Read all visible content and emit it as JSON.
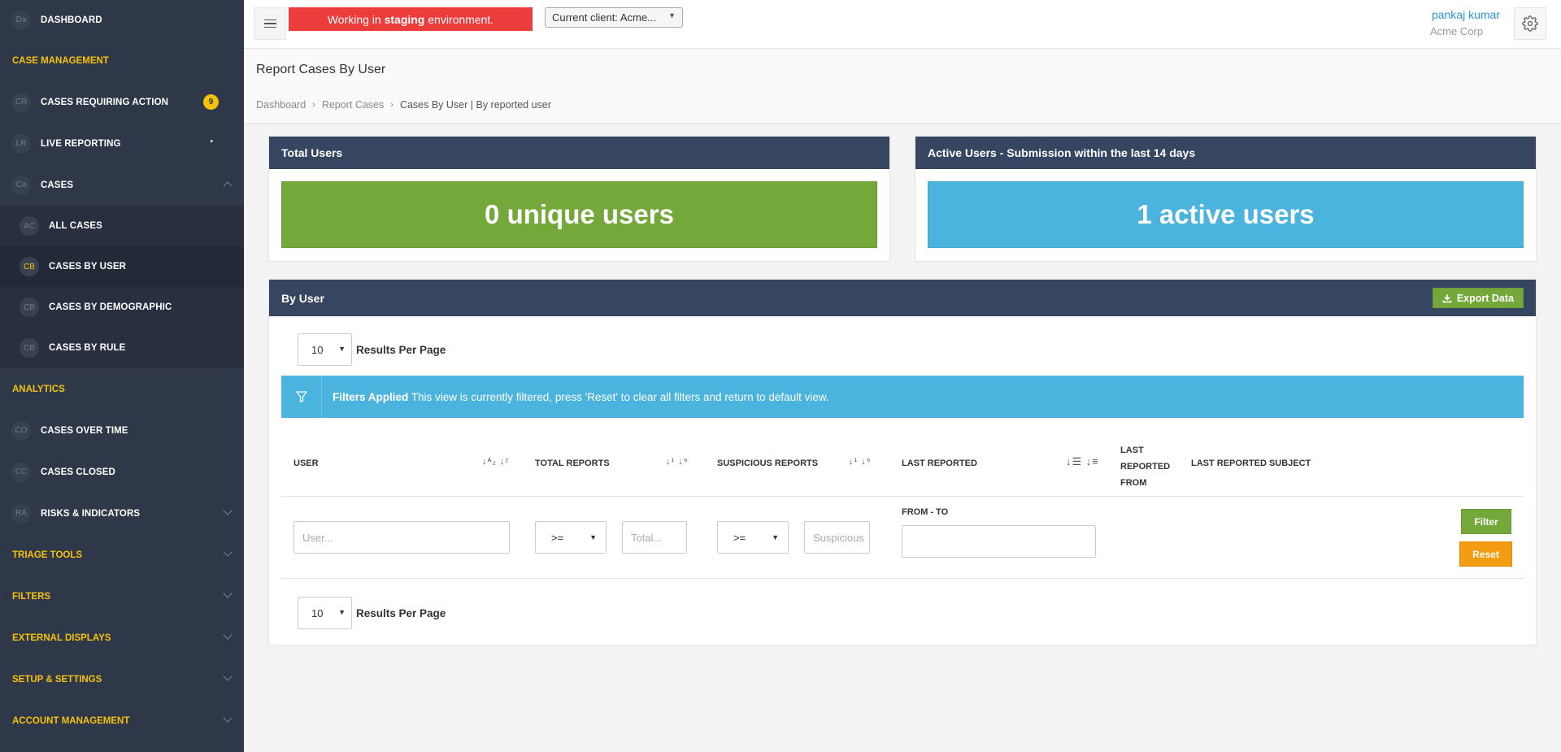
{
  "sidebar": {
    "dashboard": {
      "abbr": "Da",
      "label": "DASHBOARD"
    },
    "case_management": "CASE MANAGEMENT",
    "cases_requiring_action": {
      "abbr": "CR",
      "label": "CASES REQUIRING ACTION",
      "count": "9"
    },
    "live_reporting": {
      "abbr": "LR",
      "label": "LIVE REPORTING",
      "dot": "•"
    },
    "cases": {
      "abbr": "Ca",
      "label": "CASES"
    },
    "sub_items": [
      {
        "abbr": "AC",
        "label": "ALL CASES"
      },
      {
        "abbr": "CB",
        "label": "CASES BY USER"
      },
      {
        "abbr": "CB",
        "label": "CASES BY DEMOGRAPHIC"
      },
      {
        "abbr": "CB",
        "label": "CASES BY RULE"
      }
    ],
    "analytics": "ANALYTICS",
    "cases_over_time": {
      "abbr": "CO",
      "label": "CASES OVER TIME"
    },
    "cases_closed": {
      "abbr": "CC",
      "label": "CASES CLOSED"
    },
    "risks": {
      "abbr": "RA",
      "label": "RISKS & INDICATORS"
    },
    "triage_tools": "TRIAGE TOOLS",
    "filters": "FILTERS",
    "external_displays": "EXTERNAL DISPLAYS",
    "setup_settings": "SETUP & SETTINGS",
    "account_management": "ACCOUNT MANAGEMENT"
  },
  "topbar": {
    "staging_prefix": "Working in ",
    "staging_bold": "staging",
    "staging_suffix": " environment.",
    "client_select": "Current client: Acme...",
    "user_name": "pankaj kumar",
    "user_org": "Acme Corp"
  },
  "page": {
    "title": "Report Cases By User",
    "breadcrumb": [
      "Dashboard",
      "Report Cases",
      "Cases By User | By reported user"
    ]
  },
  "stats": {
    "total_users_title": "Total Users",
    "total_users_value": "0 unique users",
    "active_users_title": "Active Users - Submission within the last 14 days",
    "active_users_value": "1 active users",
    "colors": {
      "green": "#75a83b",
      "blue": "#4bb4de",
      "header": "#364560"
    }
  },
  "by_user": {
    "title": "By User",
    "export_label": "Export Data",
    "rpp_value": "10",
    "rpp_label": "Results Per Page",
    "filter_alert_bold": "Filters Applied",
    "filter_alert_text": " This view is currently filtered, press 'Reset' to clear all filters and return to default view.",
    "columns": {
      "user": "USER",
      "total_reports": "TOTAL REPORTS",
      "suspicious_reports": "SUSPICIOUS REPORTS",
      "last_reported": "LAST REPORTED",
      "last_reported_from": [
        "LAST",
        "REPORTED",
        "FROM"
      ],
      "last_reported_subject": "LAST REPORTED SUBJECT"
    },
    "filters": {
      "user_placeholder": "User...",
      "total_op": ">=",
      "total_placeholder": "Total...",
      "suspicious_op": ">=",
      "suspicious_placeholder": "Suspicious",
      "from_to_label": "FROM - TO",
      "filter_btn": "Filter",
      "reset_btn": "Reset"
    }
  }
}
